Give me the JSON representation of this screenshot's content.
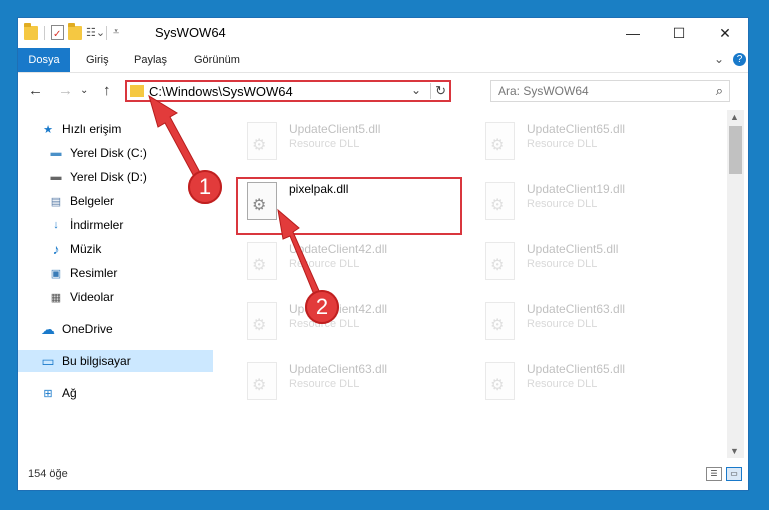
{
  "window": {
    "title": "SysWOW64"
  },
  "titlebar": {
    "minimize": "—",
    "maximize": "☐",
    "close": "✕"
  },
  "ribbon": {
    "tabs": [
      {
        "label": "Dosya",
        "active": true
      },
      {
        "label": "Giriş"
      },
      {
        "label": "Paylaş"
      },
      {
        "label": "Görünüm"
      }
    ],
    "expand": "⌄",
    "help": "?"
  },
  "nav": {
    "back": "←",
    "forward": "→",
    "recent": "⌄",
    "up": "↑",
    "address": "C:\\Windows\\SysWOW64",
    "address_dropdown": "⌄",
    "refresh": "↻",
    "search_placeholder": "Ara: SysWOW64",
    "search_icon": "⌕"
  },
  "sidebar": {
    "items": [
      {
        "label": "Hızlı erişim",
        "icon": "star-icon",
        "glyph": "★",
        "color": "#1979ca",
        "pinned": false
      },
      {
        "label": "Yerel Disk (C:)",
        "icon": "drive-icon",
        "glyph": "▬",
        "color": "#4a90c8",
        "pinned": true
      },
      {
        "label": "Yerel Disk (D:)",
        "icon": "drive-icon",
        "glyph": "▬",
        "color": "#666",
        "pinned": false
      },
      {
        "label": "Belgeler",
        "icon": "document-icon",
        "glyph": "▤",
        "color": "#5b7ea8",
        "pinned": true
      },
      {
        "label": "İndirmeler",
        "icon": "download-icon",
        "glyph": "↓",
        "color": "#1979ca",
        "pinned": true
      },
      {
        "label": "Müzik",
        "icon": "music-icon",
        "glyph": "♪",
        "color": "#1979ca",
        "pinned": true
      },
      {
        "label": "Resimler",
        "icon": "pictures-icon",
        "glyph": "▣",
        "color": "#3a7cb8",
        "pinned": true
      },
      {
        "label": "Videolar",
        "icon": "video-icon",
        "glyph": "▦",
        "color": "#555",
        "pinned": true
      },
      {
        "label": "OneDrive",
        "icon": "cloud-icon",
        "glyph": "☁",
        "color": "#1979ca",
        "pinned": false
      },
      {
        "label": "Bu bilgisayar",
        "icon": "computer-icon",
        "glyph": "▭",
        "color": "#1979ca",
        "pinned": false,
        "selected": true
      },
      {
        "label": "Ağ",
        "icon": "network-icon",
        "glyph": "⊞",
        "color": "#1979ca",
        "pinned": false
      }
    ],
    "pin_glyph": "📌"
  },
  "files": [
    {
      "name": "UpdateClient5.dll",
      "type": "Resource DLL",
      "faded": true
    },
    {
      "name": "UpdateClient65.dll",
      "type": "Resource DLL",
      "faded": true
    },
    {
      "name": "pixelpak.dll",
      "type": "",
      "faded": false
    },
    {
      "name": "UpdateClient19.dll",
      "type": "Resource DLL",
      "faded": true
    },
    {
      "name": "UpdateClient42.dll",
      "type": "Resource DLL",
      "faded": true
    },
    {
      "name": "UpdateClient5.dll",
      "type": "Resource DLL",
      "faded": true
    },
    {
      "name": "UpdateClient42.dll",
      "type": "Resource DLL",
      "faded": true
    },
    {
      "name": "UpdateClient63.dll",
      "type": "Resource DLL",
      "faded": true
    },
    {
      "name": "UpdateClient63.dll",
      "type": "Resource DLL",
      "faded": true
    },
    {
      "name": "UpdateClient65.dll",
      "type": "Resource DLL",
      "faded": true
    }
  ],
  "status": {
    "count": "154 öğe"
  },
  "annotations": {
    "step1": "1",
    "step2": "2"
  },
  "colors": {
    "accent": "#1979ca",
    "highlight": "#d9363e",
    "arrow": "#e23b3b"
  }
}
